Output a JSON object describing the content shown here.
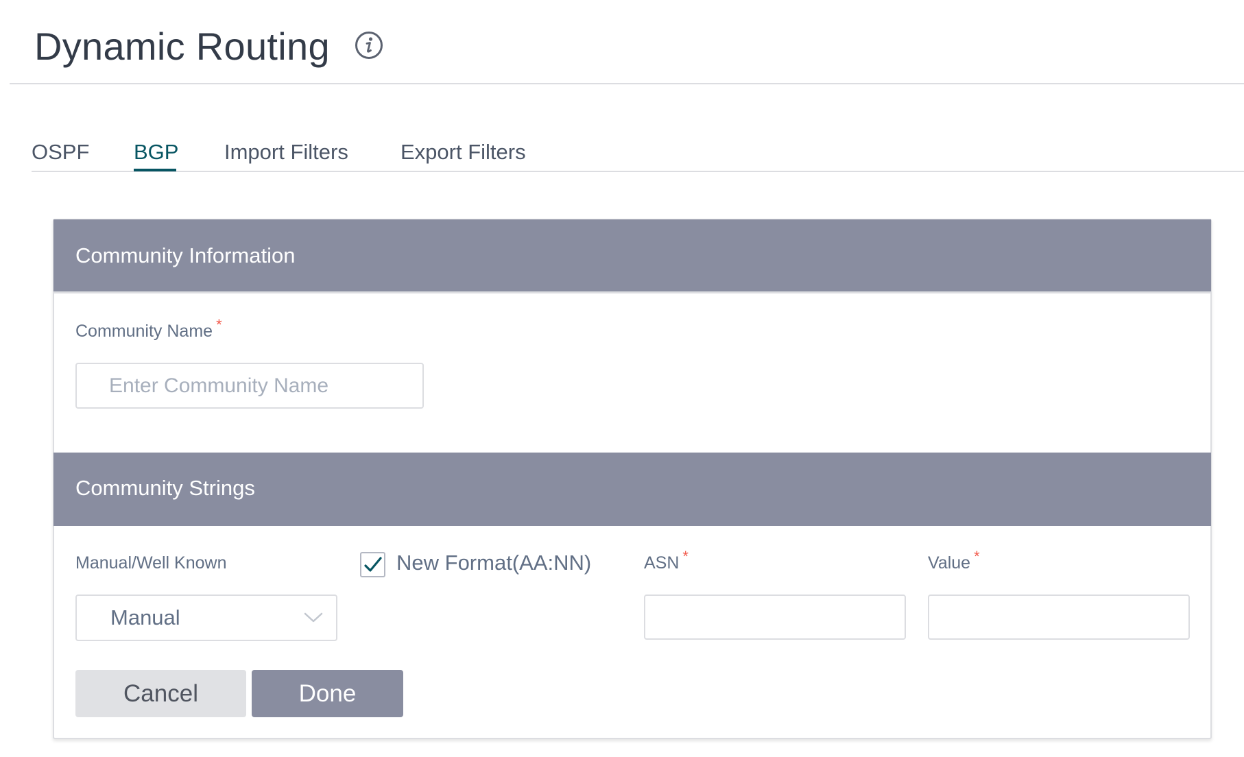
{
  "page": {
    "title": "Dynamic Routing",
    "info_icon": "info-circle-icon"
  },
  "tabs": [
    {
      "label": "OSPF",
      "active": false
    },
    {
      "label": "BGP",
      "active": true
    },
    {
      "label": "Import Filters",
      "active": false
    },
    {
      "label": "Export Filters",
      "active": false
    }
  ],
  "community_information": {
    "header": "Community Information",
    "community_name": {
      "label": "Community Name",
      "required_marker": "*",
      "value": "",
      "placeholder": "Enter Community Name"
    }
  },
  "community_strings": {
    "header": "Community Strings",
    "manual_well_known": {
      "label": "Manual/Well Known",
      "selected": "Manual",
      "icon": "chevron-down-icon"
    },
    "new_format": {
      "label": "New Format(AA:NN)",
      "checked": true,
      "icon": "checkmark-icon"
    },
    "asn": {
      "label": "ASN",
      "required_marker": "*",
      "value": ""
    },
    "value": {
      "label": "Value",
      "required_marker": "*",
      "value": ""
    }
  },
  "actions": {
    "cancel_label": "Cancel",
    "done_label": "Done"
  },
  "colors": {
    "accent": "#075562",
    "section_header_bg": "#898da0",
    "required": "#f2594b",
    "cancel_bg": "#e0e1e4",
    "done_bg": "#898da0"
  }
}
